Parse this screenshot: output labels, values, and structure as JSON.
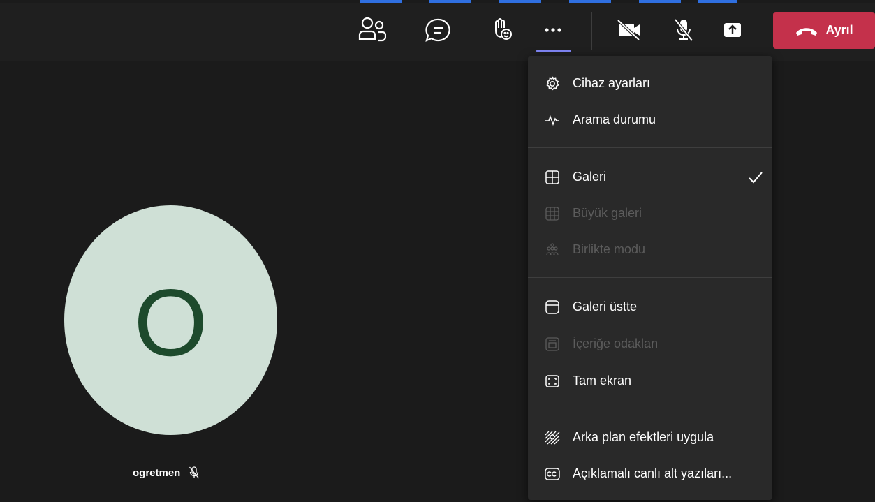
{
  "toolbar": {
    "people_label": "",
    "leave_label": "Ayrıl"
  },
  "participant": {
    "initial": "O",
    "name": "ogretmen"
  },
  "menu": {
    "items": [
      {
        "label": "Cihaz ayarları",
        "icon": "gear-icon",
        "enabled": true
      },
      {
        "label": "Arama durumu",
        "icon": "pulse-icon",
        "enabled": true
      },
      {
        "label": "Galeri",
        "icon": "grid-icon",
        "enabled": true,
        "checked": true
      },
      {
        "label": "Büyük galeri",
        "icon": "large-grid-icon",
        "enabled": false
      },
      {
        "label": "Birlikte modu",
        "icon": "together-mode-icon",
        "enabled": false
      },
      {
        "label": "Galeri üstte",
        "icon": "gallery-top-icon",
        "enabled": true
      },
      {
        "label": "İçeriğe odaklan",
        "icon": "focus-content-icon",
        "enabled": false
      },
      {
        "label": "Tam ekran",
        "icon": "fullscreen-icon",
        "enabled": true
      },
      {
        "label": "Arka plan efektleri uygula",
        "icon": "background-effects-icon",
        "enabled": true
      },
      {
        "label": "Açıklamalı canlı alt yazıları...",
        "icon": "closed-captions-icon",
        "enabled": true
      }
    ]
  },
  "colors": {
    "leave_button": "#c4314b",
    "accent": "#7f85f5",
    "avatar_bg": "#cfe0d6",
    "avatar_text": "#1d4a2c"
  }
}
